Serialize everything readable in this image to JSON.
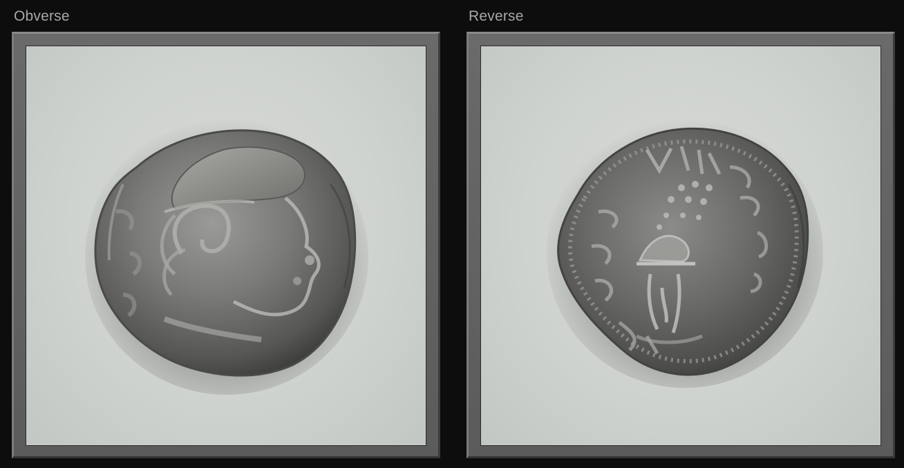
{
  "panels": {
    "obverse": {
      "label": "Obverse",
      "image": "coin-obverse-photo",
      "background_color": "#d4d7d3",
      "coin_color": "#7d7d7b"
    },
    "reverse": {
      "label": "Reverse",
      "image": "coin-reverse-photo",
      "background_color": "#d4d7d3",
      "coin_color": "#6f706e"
    }
  },
  "colors": {
    "page_background": "#0d0d0d",
    "frame": "#636363",
    "label_text": "#a8a8a8"
  }
}
